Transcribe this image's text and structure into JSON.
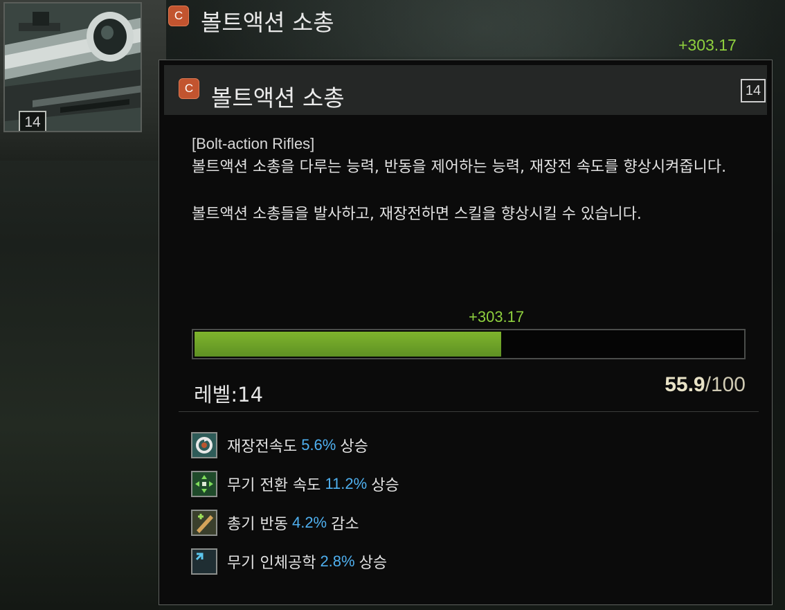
{
  "skill": {
    "name": "볼트액션 소총",
    "badge": "C",
    "level": "14",
    "xp_gain": "+303.17"
  },
  "tooltip": {
    "badge": "C",
    "title": "볼트액션 소총",
    "level": "14",
    "subtitle": "[Bolt-action Rifles]",
    "description_1": "볼트액션 소총을 다루는 능력, 반동을 제어하는 능력, 재장전 속도를 향상시켜줍니다.",
    "description_2": "볼트액션 소총들을 발사하고, 재장전하면 스킬을 향상시킬 수 있습니다.",
    "xp_gain": "+303.17",
    "level_label": "레벨:14",
    "progress": {
      "current": "55.9",
      "separator": "/",
      "max": "100",
      "fraction": 0.559
    },
    "bonuses": [
      {
        "icon": "reload-speed-icon",
        "label": "재장전속도",
        "value": "5.6%",
        "effect": "상승"
      },
      {
        "icon": "weapon-switch-icon",
        "label": "무기 전환 속도",
        "value": "11.2%",
        "effect": "상승"
      },
      {
        "icon": "recoil-icon",
        "label": "총기 반동",
        "value": "4.2%",
        "effect": "감소"
      },
      {
        "icon": "ergonomics-icon",
        "label": "무기 인체공학",
        "value": "2.8%",
        "effect": "상승"
      }
    ]
  },
  "colors": {
    "badge": "#c2542f",
    "xp": "#8fd13e",
    "progress_fill": "#6fa528",
    "bonus_value": "#4fb0f0"
  }
}
